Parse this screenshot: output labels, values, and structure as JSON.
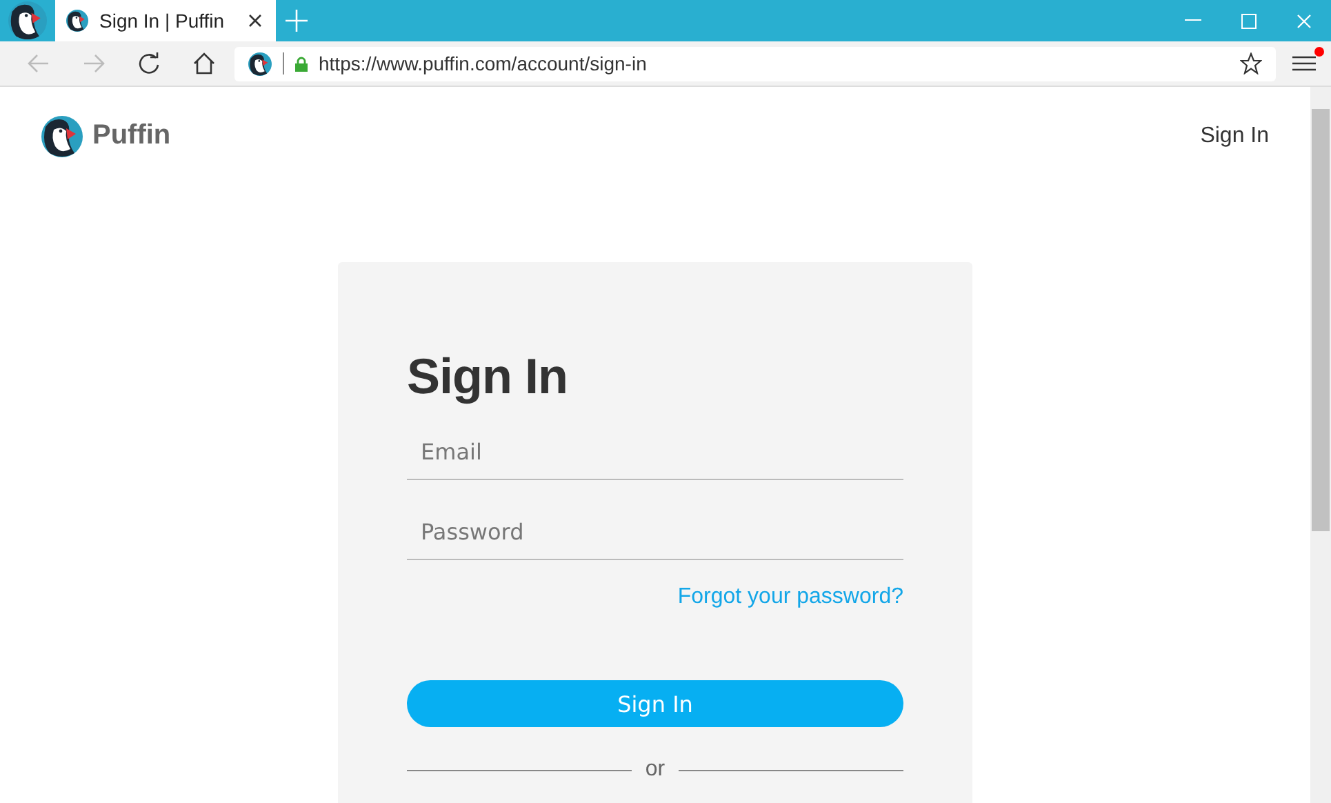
{
  "browser": {
    "tabs": [
      {
        "title": "Sign In | Puffin",
        "selected": true
      }
    ],
    "url": "https://www.puffin.com/account/sign-in",
    "menu_notification": true
  },
  "header": {
    "brand": "Puffin",
    "sign_in_link": "Sign In"
  },
  "form": {
    "title": "Sign In",
    "fields": [
      {
        "placeholder": "Email"
      },
      {
        "placeholder": "Password"
      }
    ],
    "forgot_link": "Forgot your password?",
    "submit": "Sign In",
    "divider": "or"
  }
}
